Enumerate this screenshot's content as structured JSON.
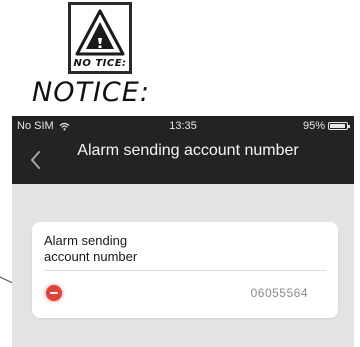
{
  "notice": {
    "icon_caption": "NO TICE:",
    "heading": "NOTICE:"
  },
  "status_bar": {
    "carrier": "No SIM",
    "time": "13:35",
    "battery": "95%"
  },
  "nav": {
    "title": "Alarm sending account number"
  },
  "card": {
    "title_line1": "Alarm sending",
    "title_line2": "account number",
    "account_number": "06055564"
  },
  "colors": {
    "header_bg": "#232323",
    "page_bg": "#e3e3e3",
    "delete_red": "#e0433a"
  }
}
